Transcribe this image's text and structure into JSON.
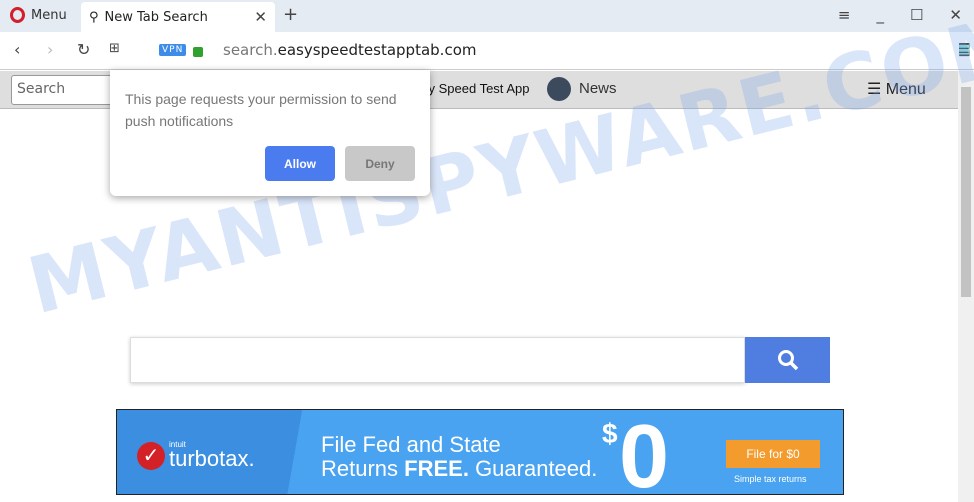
{
  "browser": {
    "menu_label": "Menu",
    "tab_title": "New Tab Search",
    "vpn": "VPN",
    "url_host": "search.",
    "url_domain": "easyspeedtestapptab.com"
  },
  "page_toolbar": {
    "search_placeholder": "Search",
    "app_link": "sy Speed Test App",
    "news": "News",
    "menu": "Menu"
  },
  "popup": {
    "message": "This page requests your permission to send push notifications",
    "allow": "Allow",
    "deny": "Deny"
  },
  "watermark": "MYANTISPYWARE.COM",
  "ad": {
    "brand_small": "intuit",
    "brand": "turbotax.",
    "line1": "File Fed and State",
    "line2_pre": "Returns ",
    "line2_bold": "FREE.",
    "line2_post": " Guaranteed.",
    "dollar": "$",
    "zero": "0",
    "button": "File for $0",
    "sub": "Simple tax returns"
  },
  "colors": {
    "accent": "#4a7cf0",
    "search_button": "#4f7de0",
    "ad_button": "#f39b2c"
  }
}
